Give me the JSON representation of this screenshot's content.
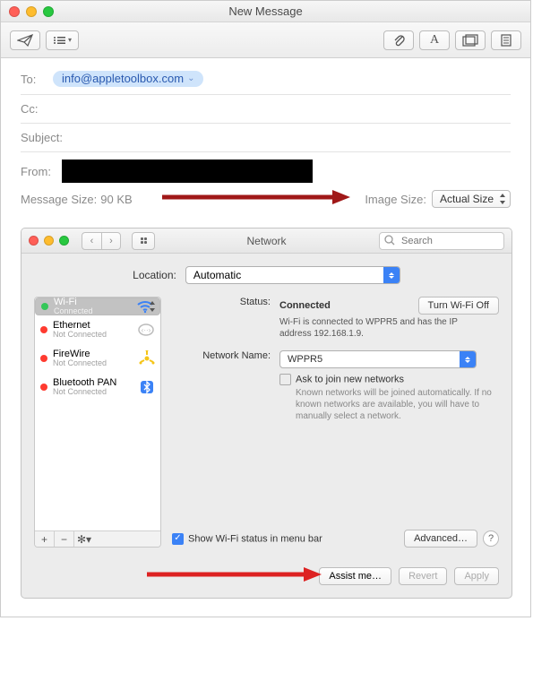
{
  "mail": {
    "title": "New Message",
    "to_label": "To:",
    "to_value": "info@appletoolbox.com",
    "cc_label": "Cc:",
    "subject_label": "Subject:",
    "from_label": "From:",
    "msg_size_label": "Message Size:",
    "msg_size_value": "90 KB",
    "img_size_label": "Image Size:",
    "img_size_value": "Actual Size"
  },
  "net": {
    "title": "Network",
    "search_placeholder": "Search",
    "location_label": "Location:",
    "location_value": "Automatic",
    "sidebar": [
      {
        "name": "Wi-Fi",
        "status": "Connected",
        "dot": "g"
      },
      {
        "name": "Ethernet",
        "status": "Not Connected",
        "dot": "r"
      },
      {
        "name": "FireWire",
        "status": "Not Connected",
        "dot": "r"
      },
      {
        "name": "Bluetooth PAN",
        "status": "Not Connected",
        "dot": "r"
      }
    ],
    "status_label": "Status:",
    "status_value": "Connected",
    "wifi_off_btn": "Turn Wi-Fi Off",
    "status_help": "Wi-Fi is connected to WPPR5 and has the IP address 192.168.1.9.",
    "network_name_label": "Network Name:",
    "network_name_value": "WPPR5",
    "ask_join": "Ask to join new networks",
    "ask_join_help": "Known networks will be joined automatically. If no known networks are available, you will have to manually select a network.",
    "show_status": "Show Wi-Fi status in menu bar",
    "advanced_btn": "Advanced…",
    "assist_btn": "Assist me…",
    "revert_btn": "Revert",
    "apply_btn": "Apply"
  }
}
